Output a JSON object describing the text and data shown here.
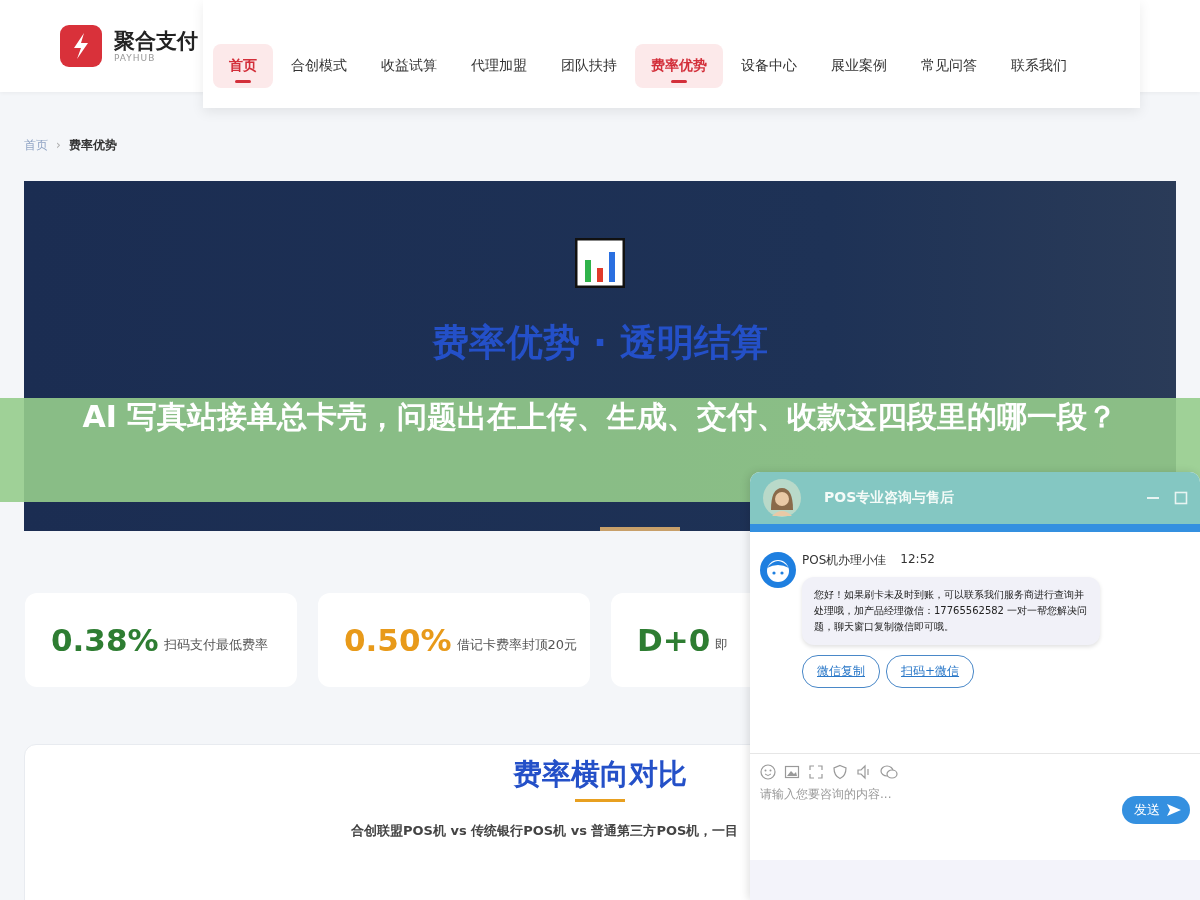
{
  "brand": {
    "name": "聚合支付",
    "sub": "PAYHUB"
  },
  "nav": [
    {
      "label": "首页",
      "selected": true
    },
    {
      "label": "合创模式",
      "selected": false
    },
    {
      "label": "收益试算",
      "selected": false
    },
    {
      "label": "代理加盟",
      "selected": false
    },
    {
      "label": "团队扶持",
      "selected": false
    },
    {
      "label": "费率优势",
      "selected": true
    },
    {
      "label": "设备中心",
      "selected": false
    },
    {
      "label": "展业案例",
      "selected": false
    },
    {
      "label": "常见问答",
      "selected": false
    },
    {
      "label": "联系我们",
      "selected": false
    }
  ],
  "breadcrumb": [
    "首页",
    "›",
    "费率优势"
  ],
  "hero": {
    "title": "费率优势 · 透明结算"
  },
  "banner": "AI 写真站接单总卡壳，问题出在上传、生成、交付、收款这四段里的哪一段？",
  "stats": [
    {
      "value": "0.38%",
      "label": "扫码支付最低费率",
      "color": "#2e7d32"
    },
    {
      "value": "0.50%",
      "label": "借记卡费率封顶20元",
      "color": "#e89a1a"
    },
    {
      "value": "D+0",
      "label": "即",
      "color": "#2e7d32"
    }
  ],
  "compare": {
    "title": "费率横向对比",
    "subtitle": "合创联盟POS机 vs 传统银行POS机 vs 普通第三方POS机，一目"
  },
  "chat": {
    "title": "POS专业咨询与售后",
    "agent": "POS机办理小佳",
    "time": "12:52",
    "message": "您好！如果刷卡未及时到账，可以联系我们服务商进行查询并处理哦，加产品经理微信：17765562582 一对一帮您解决问题，聊天窗口复制微信即可哦。",
    "actions": [
      "微信复制",
      "扫码+微信"
    ],
    "placeholder": "请输入您要咨询的内容...",
    "send": "发送"
  }
}
